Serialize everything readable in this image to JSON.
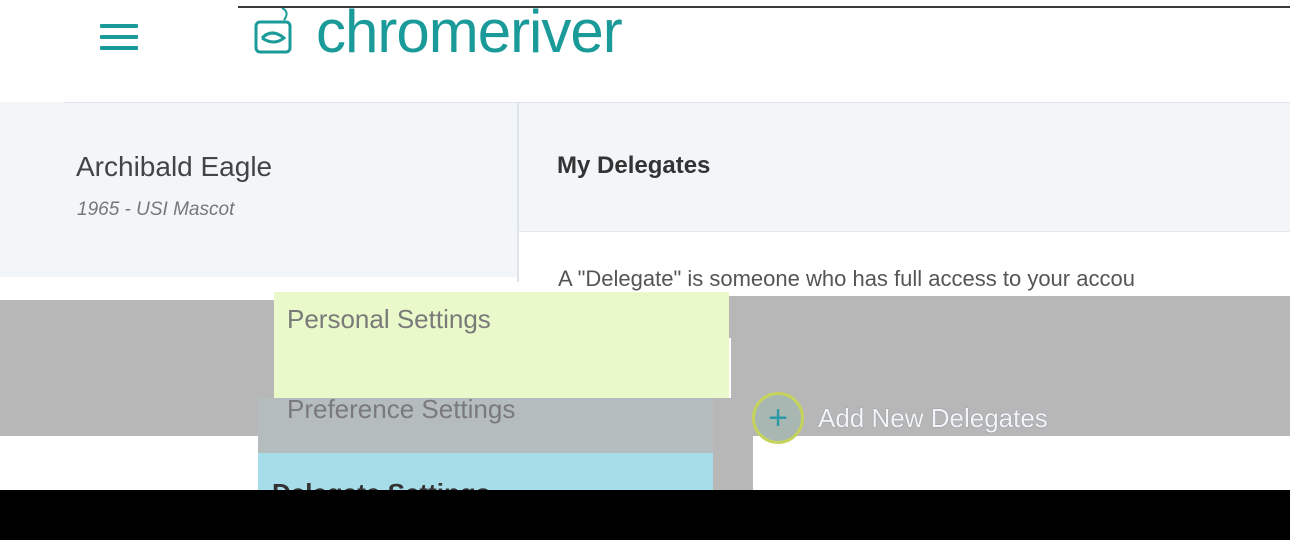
{
  "header": {
    "brand": "chromeriver",
    "menu_icon": "hamburger-menu-icon",
    "logo_icon": "chromeriver-logo-icon",
    "accent_color": "#1b9a9a"
  },
  "profile": {
    "name": "Archibald Eagle",
    "subtitle": "1965 - USI Mascot"
  },
  "main": {
    "title": "My Delegates",
    "intro": "A \"Delegate\" is someone who has full access to your accou",
    "add_button": {
      "label": "Add New Delegates",
      "icon": "plus-circle-icon"
    }
  },
  "menu": {
    "items": [
      {
        "label": "Personal Settings"
      },
      {
        "label": "Preference Settings"
      },
      {
        "label": "Delegate Settings"
      }
    ]
  }
}
